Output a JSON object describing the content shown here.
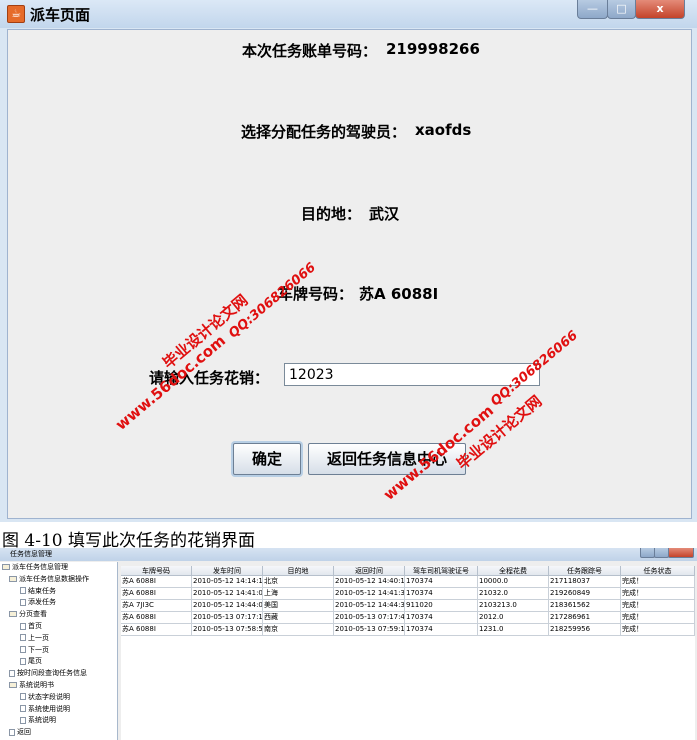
{
  "window": {
    "title": "派车页面",
    "icon": "java-cup-icon",
    "buttons": {
      "minimize": "—",
      "maximize": "□",
      "close": "x"
    }
  },
  "form": {
    "order_label": "本次任务账单号码：",
    "order_value": "219998266",
    "driver_label": "选择分配任务的驾驶员：",
    "driver_value": "xaofds",
    "dest_label": "目的地：",
    "dest_value": "武汉",
    "plate_label": "车牌号码：",
    "plate_value": "苏A 6088I",
    "cost_label": "请输入任务花销：",
    "cost_value": "12023"
  },
  "buttons": {
    "confirm": "确定",
    "back": "返回任务信息中心"
  },
  "watermarks": {
    "site": "www.56doc.com",
    "qq": "QQ:306826066",
    "brand": "毕业设计论文网"
  },
  "caption": "图 4-10  填写此次任务的花销界面",
  "window2": {
    "title": "任务信息管理",
    "tree": [
      {
        "label": "派车任务信息管理",
        "level": 0,
        "folder": true
      },
      {
        "label": "派车任务信息数据操作",
        "level": 1,
        "folder": true
      },
      {
        "label": "结束任务",
        "level": 2,
        "folder": false
      },
      {
        "label": "添发任务",
        "level": 2,
        "folder": false
      },
      {
        "label": "分页查看",
        "level": 1,
        "folder": true
      },
      {
        "label": "首页",
        "level": 2,
        "folder": false
      },
      {
        "label": "上一页",
        "level": 2,
        "folder": false
      },
      {
        "label": "下一页",
        "level": 2,
        "folder": false
      },
      {
        "label": "尾页",
        "level": 2,
        "folder": false
      },
      {
        "label": "按时间段查询任务信息",
        "level": 1,
        "folder": false
      },
      {
        "label": "系统说明书",
        "level": 1,
        "folder": true
      },
      {
        "label": "状态字段说明",
        "level": 2,
        "folder": false
      },
      {
        "label": "系统使用说明",
        "level": 2,
        "folder": false
      },
      {
        "label": "系统说明",
        "level": 2,
        "folder": false
      },
      {
        "label": "返回",
        "level": 1,
        "folder": false
      }
    ],
    "columns": [
      "车牌号码",
      "发车时间",
      "目的地",
      "返回时间",
      "驾车司机驾驶证号",
      "全程花费",
      "任务跟踪号",
      "任务状态"
    ],
    "rows": [
      [
        "苏A 6088I",
        "2010-05-12 14:14:1...",
        "北京",
        "2010-05-12 14:40:1...",
        "170374",
        "10000.0",
        "217118037",
        "完成！"
      ],
      [
        "苏A 6088I",
        "2010-05-12 14:41:0...",
        "上海",
        "2010-05-12 14:41:3...",
        "170374",
        "21032.0",
        "219260849",
        "完成！"
      ],
      [
        "苏A 7JI3C",
        "2010-05-12 14:44:0...",
        "美国",
        "2010-05-12 14:44:3...",
        "911020",
        "2103213.0",
        "218361562",
        "完成！"
      ],
      [
        "苏A 6088I",
        "2010-05-13 07:17:1...",
        "西藏",
        "2010-05-13 07:17:4...",
        "170374",
        "2012.0",
        "217286961",
        "完成！"
      ],
      [
        "苏A 6088I",
        "2010-05-13 07:58:5...",
        "南京",
        "2010-05-13 07:59:1...",
        "170374",
        "1231.0",
        "218259956",
        "完成！"
      ]
    ]
  }
}
